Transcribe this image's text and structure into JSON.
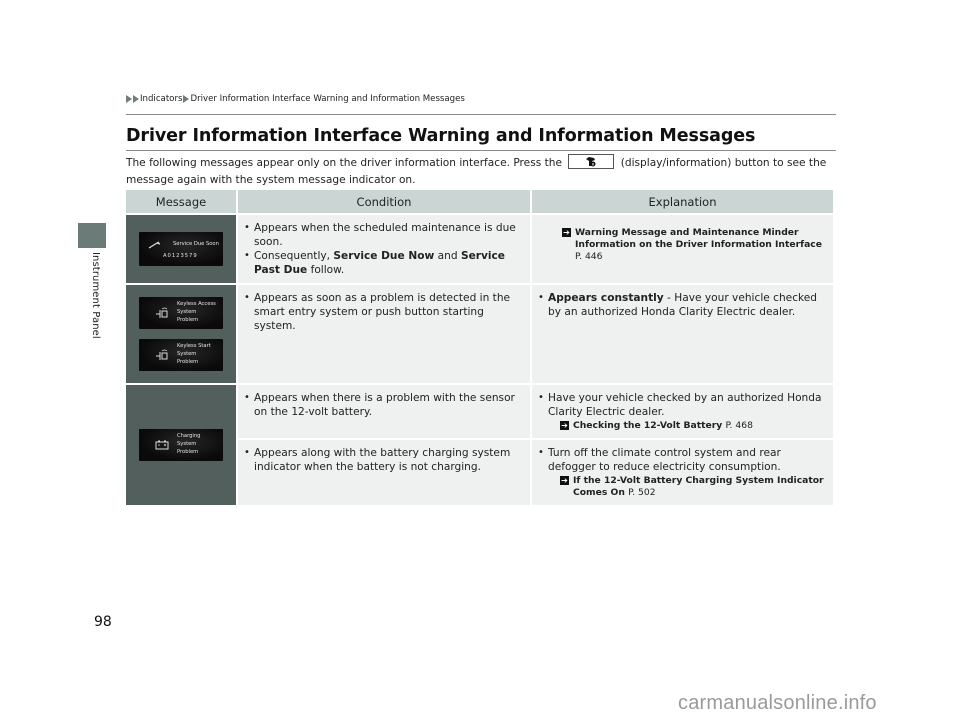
{
  "sidebar": {
    "section_label": "Instrument Panel"
  },
  "breadcrumb": [
    "Indicators",
    "Driver Information Interface Warning and Information Messages"
  ],
  "page_title": "Driver Information Interface Warning and Information Messages",
  "intro": {
    "before_button": "The following messages appear only on the driver information interface. Press the",
    "button_icon": "display-information-button-icon",
    "after_button": "(display/information) button to see the message again with the system message indicator on."
  },
  "table": {
    "headers": [
      "Message",
      "Condition",
      "Explanation"
    ],
    "rows": [
      {
        "screens": [
          {
            "icon": "wrench-icon",
            "lines": [
              "Service Due Soon"
            ],
            "code": "A0123579"
          }
        ],
        "conditions": [
          {
            "parts": [
              {
                "text": "Appears when the scheduled maintenance is due soon.",
                "bold": false
              }
            ]
          },
          {
            "parts": [
              {
                "text": "Consequently, ",
                "bold": false
              },
              {
                "text": "Service Due Now",
                "bold": true
              },
              {
                "text": " and ",
                "bold": false
              },
              {
                "text": "Service Past Due",
                "bold": true
              },
              {
                "text": " follow.",
                "bold": false
              }
            ]
          }
        ],
        "explanation": {
          "bullets": [],
          "xref": {
            "text": "Warning Message and Maintenance Minder Information on the Driver Information Interface",
            "page": "P. 446"
          }
        }
      },
      {
        "screens": [
          {
            "icon": "keyless-icon",
            "lines": [
              "Keyless Access",
              "System",
              "Problem"
            ]
          },
          {
            "icon": "keyless-icon",
            "lines": [
              "Keyless Start",
              "System",
              "Problem"
            ]
          }
        ],
        "conditions": [
          {
            "parts": [
              {
                "text": "Appears as soon as a problem is detected in the smart entry system or push button starting system.",
                "bold": false
              }
            ]
          }
        ],
        "explanation": {
          "bullets": [
            {
              "parts": [
                {
                  "text": "Appears constantly",
                  "bold": true
                },
                {
                  "text": " - Have your vehicle checked by an authorized Honda Clarity Electric dealer.",
                  "bold": false
                }
              ]
            }
          ]
        }
      },
      {
        "screens": [
          {
            "icon": "battery-icon",
            "lines": [
              "Charging",
              "System",
              "Problem"
            ]
          }
        ],
        "conditions": [
          {
            "parts": [
              {
                "text": "Appears when there is a problem with the sensor on the 12-volt battery.",
                "bold": false
              }
            ]
          }
        ],
        "explanation": {
          "bullets": [
            {
              "parts": [
                {
                  "text": "Have your vehicle checked by an authorized Honda Clarity Electric dealer.",
                  "bold": false
                }
              ]
            }
          ],
          "xref": {
            "text": "Checking the 12-Volt Battery",
            "page": "P. 468"
          }
        }
      },
      {
        "conditions": [
          {
            "parts": [
              {
                "text": "Appears along with the battery charging system indicator when the battery is not charging.",
                "bold": false
              }
            ]
          }
        ],
        "explanation": {
          "bullets": [
            {
              "parts": [
                {
                  "text": "Turn off the climate control system and rear defogger to reduce electricity consumption.",
                  "bold": false
                }
              ]
            }
          ],
          "xref": {
            "text": "If the 12-Volt Battery Charging System Indicator Comes On",
            "page": "P. 502"
          }
        }
      }
    ]
  },
  "page_number": "98",
  "watermark": "carmanualsonline.info"
}
